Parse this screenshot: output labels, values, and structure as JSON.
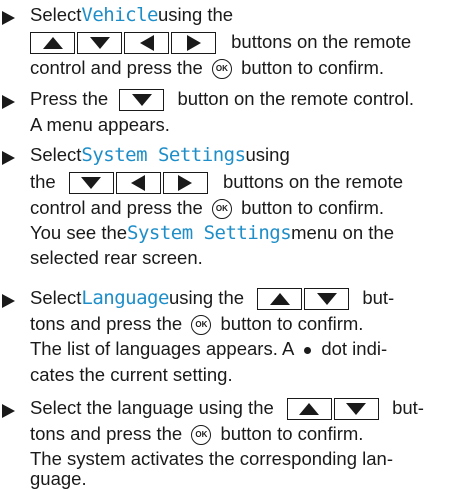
{
  "steps": [
    {
      "lines": [
        [
          "Select ",
          "Vehicle",
          " using the"
        ],
        [
          "buttons on the remote"
        ],
        [
          "control and press the",
          "button to confirm."
        ]
      ]
    },
    {
      "lines": [
        [
          "Press the",
          "button on the remote control."
        ],
        [
          "A menu appears."
        ]
      ]
    },
    {
      "lines": [
        [
          "Select ",
          "System Settings",
          " using"
        ],
        [
          "the",
          "buttons on the remote"
        ],
        [
          "control and press the",
          "button to confirm."
        ],
        [
          "You see the ",
          "System Settings",
          " menu on the"
        ],
        [
          "selected rear screen."
        ]
      ]
    },
    {
      "lines": [
        [
          "Select ",
          "Language",
          " using the",
          "but-"
        ],
        [
          "tons and press the",
          "button to confirm."
        ],
        [
          "The list of languages appears. A",
          "dot indi-"
        ],
        [
          "cates the current setting."
        ]
      ]
    },
    {
      "lines": [
        [
          "Select the language using the",
          "but-"
        ],
        [
          "tons and press the",
          "button to confirm."
        ],
        [
          "The system activates the corresponding lan-"
        ],
        [
          "guage."
        ]
      ]
    }
  ],
  "ok_label": "OK",
  "icons": {
    "bullet": "right-triangle-bullet",
    "up": "up-arrow-key",
    "down": "down-arrow-key",
    "left": "left-arrow-key",
    "right": "right-arrow-key",
    "ok": "ok-button"
  },
  "colors": {
    "highlight": "#1e8ec9",
    "text": "#1a1a1a"
  }
}
